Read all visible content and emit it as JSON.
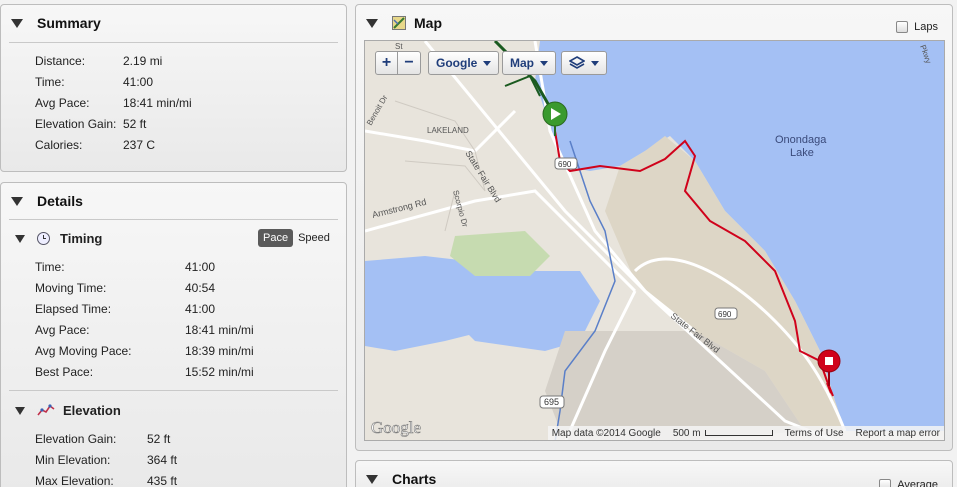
{
  "summary": {
    "title": "Summary",
    "rows": [
      {
        "label": "Distance:",
        "value": "2.19 mi"
      },
      {
        "label": "Time:",
        "value": "41:00"
      },
      {
        "label": "Avg Pace:",
        "value": "18:41 min/mi"
      },
      {
        "label": "Elevation Gain:",
        "value": "52 ft"
      },
      {
        "label": "Calories:",
        "value": "237 C"
      }
    ]
  },
  "details": {
    "title": "Details",
    "timing": {
      "title": "Timing",
      "toggle_pace": "Pace",
      "toggle_speed": "Speed",
      "rows": [
        {
          "label": "Time:",
          "value": "41:00"
        },
        {
          "label": "Moving Time:",
          "value": "40:54"
        },
        {
          "label": "Elapsed Time:",
          "value": "41:00"
        },
        {
          "label": "Avg Pace:",
          "value": "18:41 min/mi"
        },
        {
          "label": "Avg Moving Pace:",
          "value": "18:39 min/mi"
        },
        {
          "label": "Best Pace:",
          "value": "15:52 min/mi"
        }
      ]
    },
    "elevation": {
      "title": "Elevation",
      "rows": [
        {
          "label": "Elevation Gain:",
          "value": "52 ft"
        },
        {
          "label": "Min Elevation:",
          "value": "364 ft"
        },
        {
          "label": "Max Elevation:",
          "value": "435 ft"
        }
      ]
    }
  },
  "map": {
    "title": "Map",
    "laps_label": "Laps",
    "zoom_in": "+",
    "zoom_out": "−",
    "provider_label": "Google",
    "map_type_label": "Map",
    "labels": {
      "lake": "Onondaga\nLake",
      "lake1": "Onondaga",
      "lake2": "Lake",
      "lakeland": "LAKELAND",
      "state_fair_1": "State Fair Blvd",
      "state_fair_2": "State Fair Blvd",
      "armstrong": "Armstrong Rd",
      "scorpio": "Scorpio Dr",
      "benoit": "Benoit Dr",
      "pkwy": "Pkwy",
      "st": "St",
      "route_690a": "690",
      "route_690b": "690",
      "route_695": "695",
      "google_logo": "Google"
    },
    "attribution": {
      "data": "Map data ©2014 Google",
      "scale": "500 m",
      "terms": "Terms of Use",
      "report": "Report a map error"
    },
    "colors": {
      "water": "#a4c0f4",
      "land": "#e8e4dc",
      "route": "#d0021b",
      "start": "#3a9a2e"
    }
  },
  "charts": {
    "title": "Charts",
    "average_label": "Average"
  }
}
